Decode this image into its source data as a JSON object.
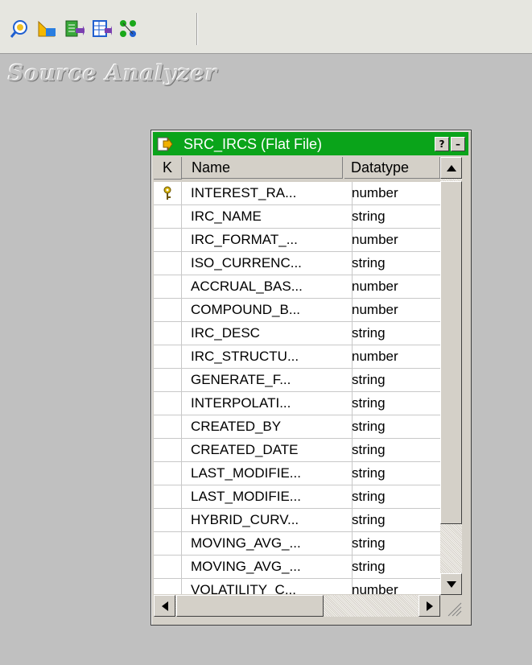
{
  "toolbar": {
    "buttons": [
      {
        "icon": "source-analyzer-icon"
      },
      {
        "icon": "target-designer-icon"
      },
      {
        "icon": "transformation-developer-icon"
      },
      {
        "icon": "mapplet-designer-icon"
      },
      {
        "icon": "mapping-designer-icon"
      }
    ]
  },
  "workspace": {
    "title": "Source Analyzer"
  },
  "source_window": {
    "title": "SRC_IRCS (Flat File)",
    "help_button": "?",
    "minimize_button": "–",
    "columns": {
      "key": "K",
      "name": "Name",
      "datatype": "Datatype"
    },
    "rows": [
      {
        "key": true,
        "name": "INTEREST_RA...",
        "type": "number"
      },
      {
        "key": false,
        "name": "IRC_NAME",
        "type": "string"
      },
      {
        "key": false,
        "name": "IRC_FORMAT_...",
        "type": "number"
      },
      {
        "key": false,
        "name": "ISO_CURRENC...",
        "type": "string"
      },
      {
        "key": false,
        "name": "ACCRUAL_BAS...",
        "type": "number"
      },
      {
        "key": false,
        "name": "COMPOUND_B...",
        "type": "number"
      },
      {
        "key": false,
        "name": "IRC_DESC",
        "type": "string"
      },
      {
        "key": false,
        "name": "IRC_STRUCTU...",
        "type": "number"
      },
      {
        "key": false,
        "name": "GENERATE_F...",
        "type": "string"
      },
      {
        "key": false,
        "name": "INTERPOLATI...",
        "type": "string"
      },
      {
        "key": false,
        "name": "CREATED_BY",
        "type": "string"
      },
      {
        "key": false,
        "name": "CREATED_DATE",
        "type": "string"
      },
      {
        "key": false,
        "name": "LAST_MODIFIE...",
        "type": "string"
      },
      {
        "key": false,
        "name": "LAST_MODIFIE...",
        "type": "string"
      },
      {
        "key": false,
        "name": "HYBRID_CURV...",
        "type": "string"
      },
      {
        "key": false,
        "name": "MOVING_AVG_...",
        "type": "string"
      },
      {
        "key": false,
        "name": "MOVING_AVG_...",
        "type": "string"
      },
      {
        "key": false,
        "name": "VOLATILITY_C...",
        "type": "number"
      }
    ],
    "colors": {
      "titlebar": "#0aa41a",
      "key_icon": "#d4b000"
    }
  }
}
